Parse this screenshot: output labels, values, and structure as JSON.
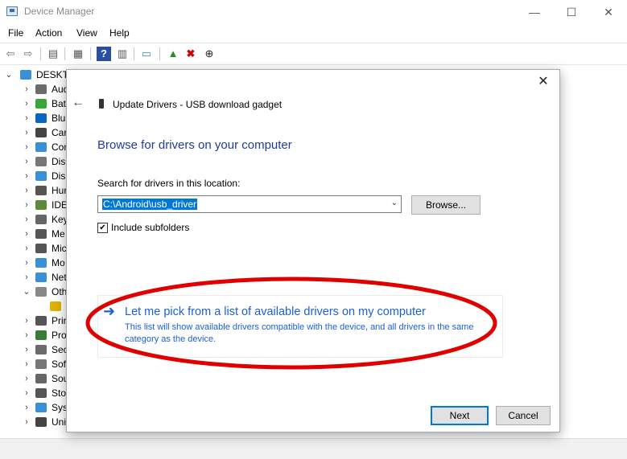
{
  "window": {
    "title": "Device Manager",
    "minimize": "—",
    "maximize": "☐",
    "close": "✕"
  },
  "menu": [
    "File",
    "Action",
    "View",
    "Help"
  ],
  "toolbar": {
    "back": "⇦",
    "forward": "⇨",
    "properties": "▤",
    "list": "▦",
    "help": "?",
    "details": "▥",
    "monitor": "▭",
    "update": "▲",
    "uninstall": "✖",
    "download": "⊕"
  },
  "tree": {
    "root": "DESKTO",
    "items": [
      {
        "label": "Aud",
        "icon": "audio-icon",
        "color": "#6b6b6b"
      },
      {
        "label": "Bat",
        "icon": "battery-icon",
        "color": "#3aa63a"
      },
      {
        "label": "Blu",
        "icon": "bluetooth-icon",
        "color": "#0a66c2"
      },
      {
        "label": "Car",
        "icon": "camera-icon",
        "color": "#444444"
      },
      {
        "label": "Con",
        "icon": "computer-icon",
        "color": "#3a8fd6"
      },
      {
        "label": "Disl",
        "icon": "disk-icon",
        "color": "#777777"
      },
      {
        "label": "Disp",
        "icon": "display-icon",
        "color": "#3a8fd6"
      },
      {
        "label": "Hur",
        "icon": "hid-icon",
        "color": "#555555"
      },
      {
        "label": "IDE",
        "icon": "ide-icon",
        "color": "#5a8a3a"
      },
      {
        "label": "Key",
        "icon": "keyboard-icon",
        "color": "#666666"
      },
      {
        "label": "Me",
        "icon": "memory-icon",
        "color": "#555555"
      },
      {
        "label": "Mic",
        "icon": "mouse-icon",
        "color": "#555555"
      },
      {
        "label": "Mo",
        "icon": "monitor-icon",
        "color": "#3a8fd6"
      },
      {
        "label": "Net",
        "icon": "network-icon",
        "color": "#3a8fd6"
      },
      {
        "label": "Oth",
        "icon": "other-devices-icon",
        "color": "#888888"
      },
      {
        "label": "",
        "icon": "warning-device-icon",
        "color": "#e0b000"
      },
      {
        "label": "Prir",
        "icon": "printer-icon",
        "color": "#555555"
      },
      {
        "label": "Pro",
        "icon": "processor-icon",
        "color": "#3a7a3a"
      },
      {
        "label": "Sec",
        "icon": "security-icon",
        "color": "#6b6b6b"
      },
      {
        "label": "Sof",
        "icon": "software-icon",
        "color": "#777777"
      },
      {
        "label": "Sou",
        "icon": "sound-icon",
        "color": "#666666"
      },
      {
        "label": "Sto",
        "icon": "storage-icon",
        "color": "#555555"
      },
      {
        "label": "Sys",
        "icon": "system-icon",
        "color": "#3a8fd6"
      },
      {
        "label": "Uni",
        "icon": "usb-icon",
        "color": "#444444"
      }
    ]
  },
  "dialog": {
    "title": "Update Drivers - USB download gadget",
    "heading": "Browse for drivers on your computer",
    "search_label": "Search for drivers in this location:",
    "path_value": "C:\\Android\\usb_driver",
    "browse_button": "Browse...",
    "include_subfolders": "Include subfolders",
    "include_subfolders_checked": "✔",
    "pick_title": "Let me pick from a list of available drivers on my computer",
    "pick_desc": "This list will show available drivers compatible with the device, and all drivers in the same category as the device.",
    "next_button": "Next",
    "cancel_button": "Cancel",
    "close": "✕",
    "back": "←",
    "accent": "#1e5fd6",
    "heading_color": "#1e3d99",
    "annotation_color": "#e00000"
  }
}
